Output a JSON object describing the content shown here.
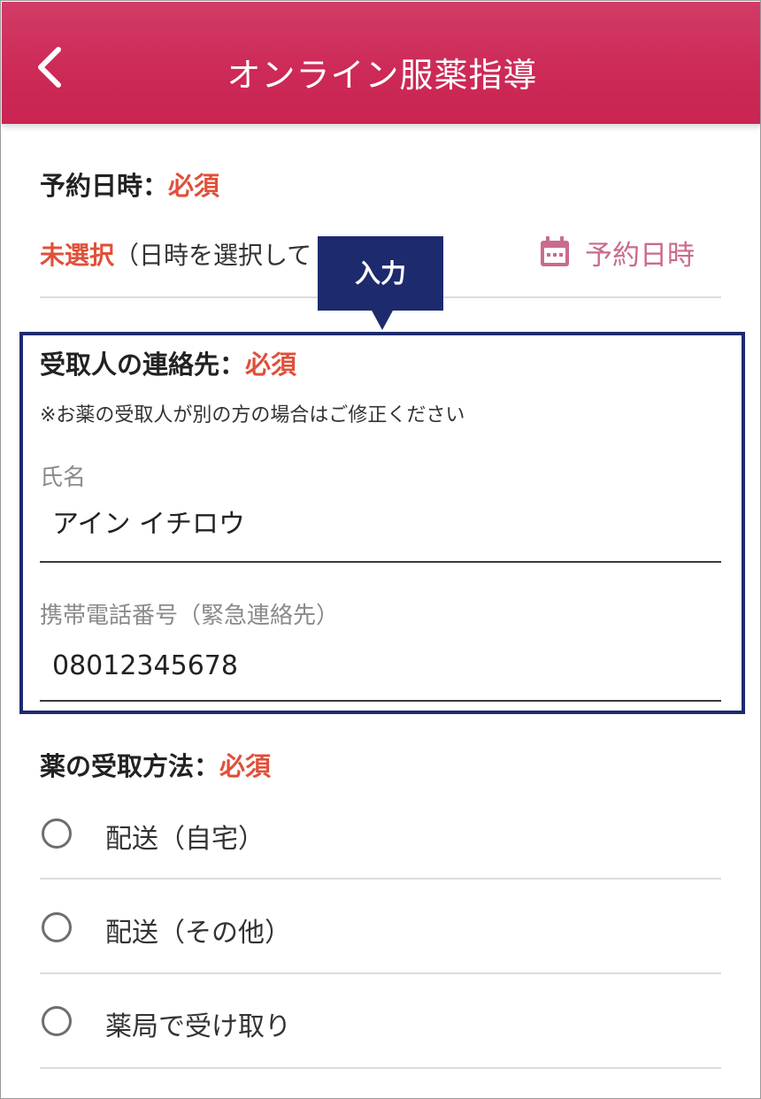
{
  "header": {
    "title": "オンライン服薬指導",
    "back_icon": "chevron-left-icon"
  },
  "reservation": {
    "label": "予約日時：",
    "required": "必須",
    "status": "未選択",
    "hint": "（日時を選択して",
    "picker_label": "予約日時",
    "picker_icon": "calendar-icon"
  },
  "annotation": {
    "tag": "入力"
  },
  "contact": {
    "label": "受取人の連絡先：",
    "required": "必須",
    "note": "※お薬の受取人が別の方の場合はご修正ください",
    "name_label": "氏名",
    "name_value": "アイン イチロウ",
    "phone_label": "携帯電話番号（緊急連絡先）",
    "phone_value": "08012345678"
  },
  "receipt": {
    "label": "薬の受取方法：",
    "required": "必須",
    "options": [
      {
        "label": "配送（自宅）"
      },
      {
        "label": "配送（その他）"
      },
      {
        "label": "薬局で受け取り"
      }
    ]
  },
  "colors": {
    "header": "#cd2a57",
    "required": "#e0503a",
    "annotation": "#1e2a6e",
    "picker": "#c96b8e"
  }
}
